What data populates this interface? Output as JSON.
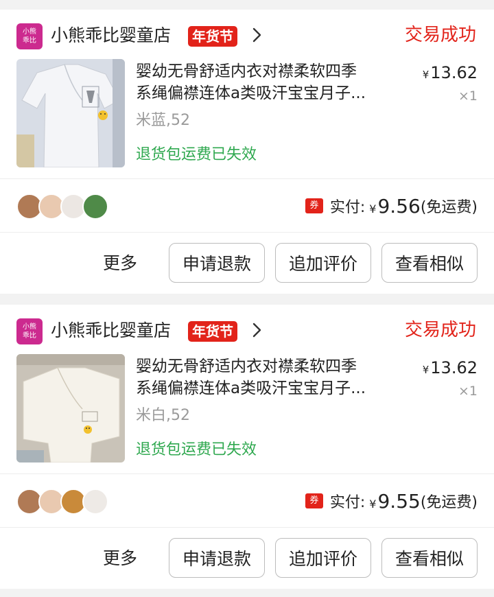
{
  "orders": [
    {
      "shop_logo_text": [
        "小熊",
        "乖比"
      ],
      "shop_name": "小熊乖比婴童店",
      "festival_badge": "年货节",
      "status": "交易成功",
      "title_line1": "婴幼无骨舒适内衣对襟柔软四季",
      "title_line2": "系绳偏襟连体a类吸汗宝宝月子...",
      "price_currency": "¥",
      "price": "13.62",
      "quantity": "×1",
      "spec": "米蓝,52",
      "return_note": "退货包运费已失效",
      "coupon_icon": "券",
      "pay_label": "实付:",
      "pay_currency": "¥",
      "pay_amount": "9.56",
      "pay_note": "(免运费)",
      "avatar_colors": [
        "#b07a55",
        "#e9c9b0",
        "#ece7e3",
        "#4f8a48"
      ],
      "thumb_colors": {
        "bg": "#d8dde6",
        "garment": "#f4f5f8",
        "accent": "#f2c12e"
      },
      "actions": {
        "more": "更多",
        "refund": "申请退款",
        "review": "追加评价",
        "similar": "查看相似"
      }
    },
    {
      "shop_logo_text": [
        "小熊",
        "乖比"
      ],
      "shop_name": "小熊乖比婴童店",
      "festival_badge": "年货节",
      "status": "交易成功",
      "title_line1": "婴幼无骨舒适内衣对襟柔软四季",
      "title_line2": "系绳偏襟连体a类吸汗宝宝月子...",
      "price_currency": "¥",
      "price": "13.62",
      "quantity": "×1",
      "spec": "米白,52",
      "return_note": "退货包运费已失效",
      "coupon_icon": "券",
      "pay_label": "实付:",
      "pay_currency": "¥",
      "pay_amount": "9.55",
      "pay_note": "(免运费)",
      "avatar_colors": [
        "#b07a55",
        "#e9c9b0",
        "#c98a3a",
        "#eeeae6"
      ],
      "thumb_colors": {
        "bg": "#c9c3b8",
        "garment": "#f5f2ea",
        "accent": "#f2c12e"
      },
      "actions": {
        "more": "更多",
        "refund": "申请退款",
        "review": "追加评价",
        "similar": "查看相似"
      }
    }
  ],
  "colors": {
    "accent_red": "#e2231a",
    "success_green": "#2fa84f",
    "shop_logo": "#cc2a8f"
  }
}
